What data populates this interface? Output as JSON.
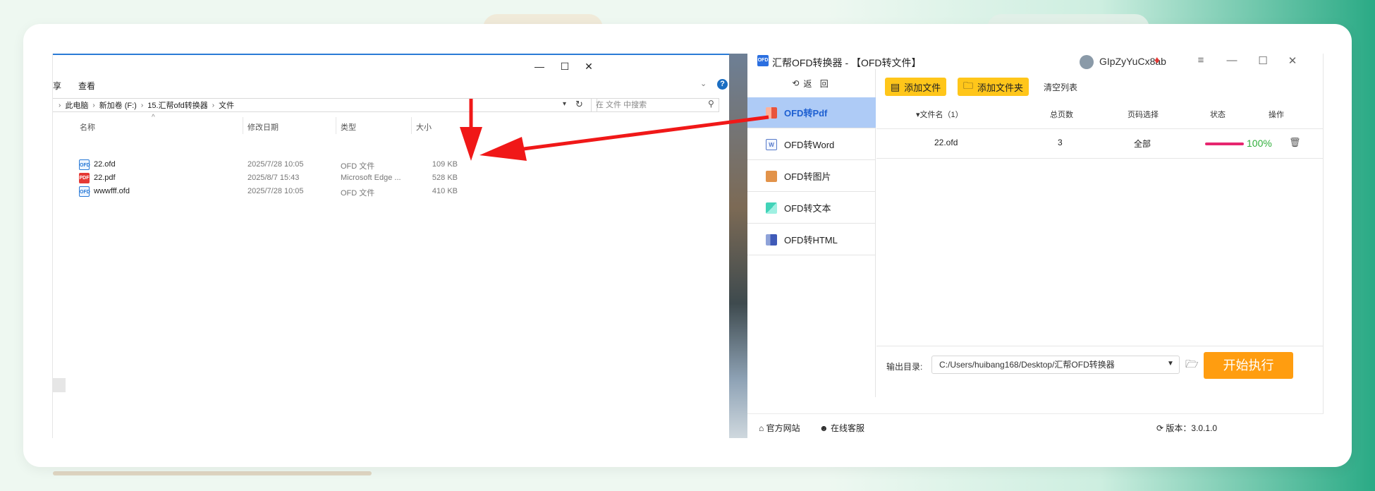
{
  "explorer": {
    "menu_share": "享",
    "menu_view": "查看",
    "window_minimize": "—",
    "window_maximize": "☐",
    "window_close": "✕",
    "help": "?",
    "collapse": "⌄",
    "breadcrumb": [
      "此电脑",
      "新加卷 (F:)",
      "15.汇帮ofd转换器",
      "文件"
    ],
    "search_placeholder": "在 文件 中搜索",
    "columns": {
      "name": "名称",
      "date": "修改日期",
      "type": "类型",
      "size": "大小"
    },
    "files": [
      {
        "name": "22.ofd",
        "date": "2025/7/28 10:05",
        "type": "OFD 文件",
        "size": "109 KB",
        "icon": "ofd-file-icon"
      },
      {
        "name": "22.pdf",
        "date": "2025/8/7 15:43",
        "type": "Microsoft Edge ...",
        "size": "528 KB",
        "icon": "pdf-file-icon"
      },
      {
        "name": "wwwfff.ofd",
        "date": "2025/7/28 10:05",
        "type": "OFD 文件",
        "size": "410 KB",
        "icon": "ofd-file-icon"
      }
    ]
  },
  "app": {
    "title": "汇帮OFD转换器 - 【OFD转文件】",
    "username": "GIpZyYuCx8ab",
    "window_menu": "≡",
    "window_minimize": "—",
    "window_maximize": "☐",
    "window_close": "✕",
    "back_label": "返 回",
    "nav": [
      {
        "label": "OFD转Pdf",
        "active": true
      },
      {
        "label": "OFD转Word",
        "active": false
      },
      {
        "label": "OFD转图片",
        "active": false
      },
      {
        "label": "OFD转文本",
        "active": false
      },
      {
        "label": "OFD转HTML",
        "active": false
      }
    ],
    "toolbar": {
      "add_file": "添加文件",
      "add_folder": "添加文件夹",
      "clear_list": "清空列表"
    },
    "table": {
      "headers": {
        "filename": "▾文件名（1）",
        "pages": "总页数",
        "page_select": "页码选择",
        "status": "状态",
        "action": "操作"
      },
      "rows": [
        {
          "filename": "22.ofd",
          "pages": "3",
          "page_select": "全部",
          "progress": 100,
          "progress_text": "100%"
        }
      ]
    },
    "output": {
      "label": "输出目录:",
      "path": "C:/Users/huibang168/Desktop/汇帮OFD转换器"
    },
    "start_button": "开始执行",
    "footer": {
      "website": "官方网站",
      "service": "在线客服",
      "version": "版本：3.0.1.0"
    }
  },
  "colors": {
    "accent_yellow": "#ffc61a",
    "start_orange": "#ff9d10",
    "active_nav": "#aecbf6",
    "arrow_red": "#f01818",
    "progress": "#e6266f"
  }
}
